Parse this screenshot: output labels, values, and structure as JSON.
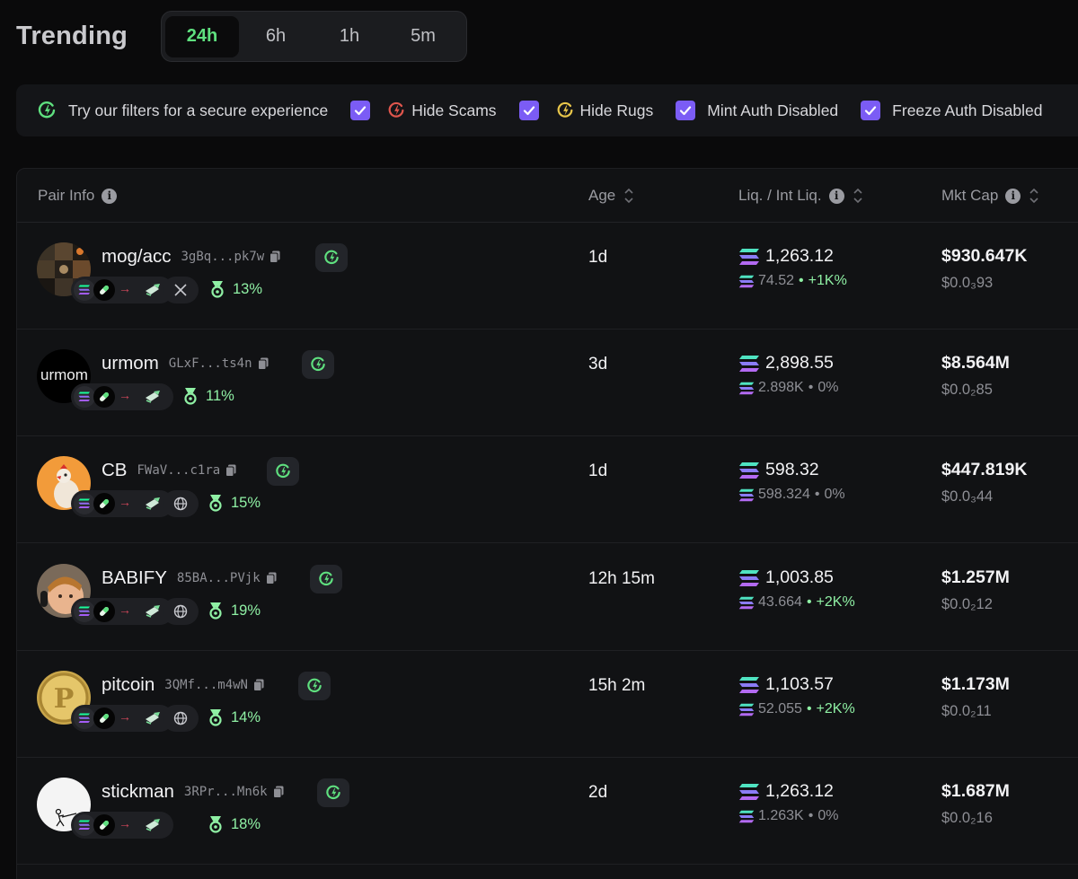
{
  "header": {
    "title": "Trending"
  },
  "timeframes": [
    {
      "label": "24h",
      "active": true
    },
    {
      "label": "6h",
      "active": false
    },
    {
      "label": "1h",
      "active": false
    },
    {
      "label": "5m",
      "active": false
    }
  ],
  "filters": {
    "tip": "Try our filters for a secure experience",
    "items": [
      {
        "label": "Hide Scams",
        "checked": true,
        "icon": "scam-shield-icon"
      },
      {
        "label": "Hide Rugs",
        "checked": true,
        "icon": "rug-shield-icon"
      },
      {
        "label": "Mint Auth Disabled",
        "checked": true
      },
      {
        "label": "Freeze Auth Disabled",
        "checked": true
      }
    ]
  },
  "columns": {
    "pair_info": "Pair Info",
    "age": "Age",
    "liquidity": "Liq. / Int Liq.",
    "market_cap": "Mkt Cap"
  },
  "colors": {
    "accent_green": "#5fe07f",
    "checkbox_purple": "#7b5cf5",
    "positive": "#8ff0a4"
  },
  "rows": [
    {
      "name": "mog/acc",
      "address": "3gBq...pk7w",
      "social": "x-icon",
      "holders_pct": "13%",
      "age": "1d",
      "liq": "1,263.12",
      "init_liq": "74.52",
      "liq_change": "+1K%",
      "mkt_cap": "$930.647K",
      "price": "$0.0₃93"
    },
    {
      "name": "urmom",
      "address": "GLxF...ts4n",
      "social": null,
      "holders_pct": "11%",
      "age": "3d",
      "liq": "2,898.55",
      "init_liq": "2.898K",
      "liq_change": "0%",
      "mkt_cap": "$8.564M",
      "price": "$0.0₂85",
      "avatar_text": "urmom"
    },
    {
      "name": "CB",
      "address": "FWaV...c1ra",
      "social": "globe-icon",
      "holders_pct": "15%",
      "age": "1d",
      "liq": "598.32",
      "init_liq": "598.324",
      "liq_change": "0%",
      "mkt_cap": "$447.819K",
      "price": "$0.0₃44"
    },
    {
      "name": "BABIFY",
      "address": "85BA...PVjk",
      "social": "globe-icon",
      "holders_pct": "19%",
      "age": "12h 15m",
      "liq": "1,003.85",
      "init_liq": "43.664",
      "liq_change": "+2K%",
      "mkt_cap": "$1.257M",
      "price": "$0.0₂12"
    },
    {
      "name": "pitcoin",
      "address": "3QMf...m4wN",
      "social": "globe-icon",
      "holders_pct": "14%",
      "age": "15h 2m",
      "liq": "1,103.57",
      "init_liq": "52.055",
      "liq_change": "+2K%",
      "mkt_cap": "$1.173M",
      "price": "$0.0₂11"
    },
    {
      "name": "stickman",
      "address": "3RPr...Mn6k",
      "social": null,
      "holders_pct": "18%",
      "age": "2d",
      "liq": "1,263.12",
      "init_liq": "1.263K",
      "liq_change": "0%",
      "mkt_cap": "$1.687M",
      "price": "$0.0₂16"
    }
  ]
}
